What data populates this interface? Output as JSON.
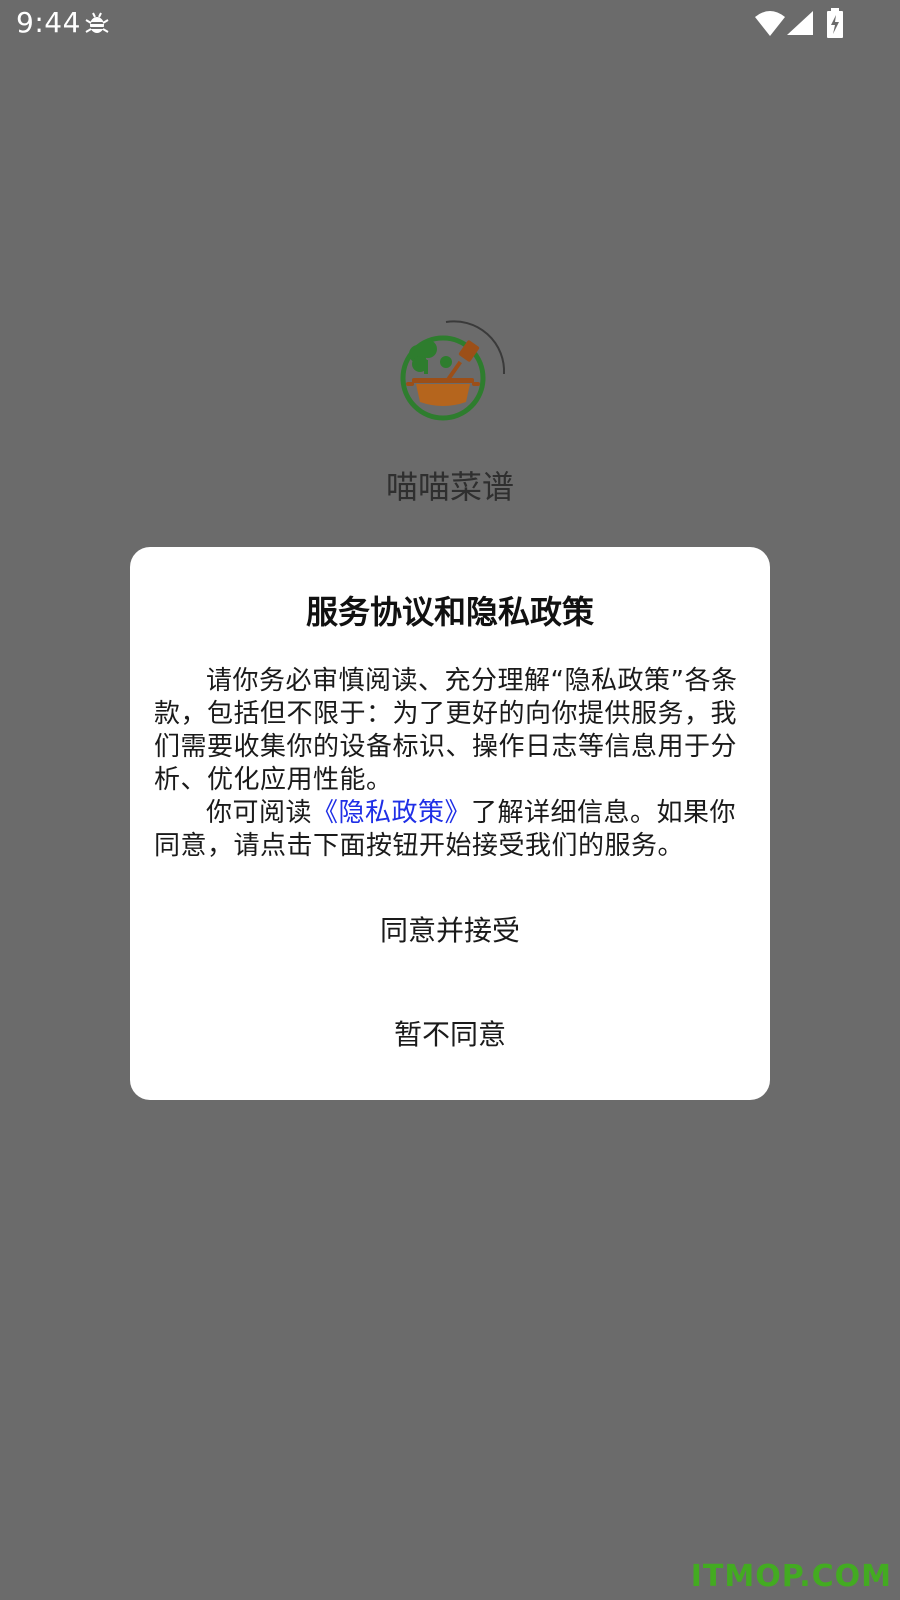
{
  "status_bar": {
    "time": "9:44",
    "icons": [
      "debug-icon",
      "wifi-icon",
      "signal-icon",
      "battery-charging-icon"
    ]
  },
  "splash": {
    "app_name": "喵喵菜谱",
    "logo": "cooking-pot-logo"
  },
  "dialog": {
    "title": "服务协议和隐私政策",
    "paragraph1": "请你务必审慎阅读、充分理解“隐私政策”各条款，包括但不限于：为了更好的向你提供服务，我们需要收集你的设备标识、操作日志等信息用于分析、优化应用性能。",
    "paragraph2_before": "你可阅读",
    "privacy_link": "《隐私政策》",
    "paragraph2_after": "了解详细信息。如果你同意，请点击下面按钮开始接受我们的服务。",
    "agree_button": "同意并接受",
    "disagree_button": "暂不同意"
  },
  "watermark": "ITMOP.COM",
  "colors": {
    "overlay": "#6b6b6b",
    "link": "#1f2fe6",
    "logo_green": "#2e8b2e",
    "logo_brown": "#a0541a",
    "watermark": "#3fb31a"
  }
}
